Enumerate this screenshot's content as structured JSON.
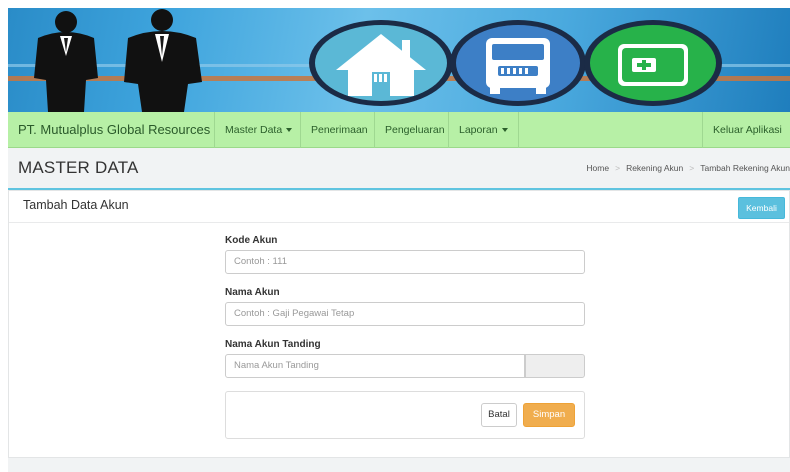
{
  "colors": {
    "navbar_bg": "#b7f0a6",
    "banner_sky": "#3ea4dd",
    "accent_info": "#5bc0de",
    "accent_warning": "#f0ad4e",
    "home_circle": "#5bb8d6",
    "bus_circle": "#3d7fc6",
    "wallet_circle": "#27b24a"
  },
  "banner": {
    "icons": [
      "businessman-silhouette",
      "businessman-silhouette",
      "home-icon",
      "bus-icon",
      "wallet-icon"
    ]
  },
  "navbar": {
    "brand": "PT. Mutualplus Global Resources",
    "items": [
      {
        "label": "Master Data",
        "dropdown": true
      },
      {
        "label": "Penerimaan",
        "dropdown": false
      },
      {
        "label": "Pengeluaran",
        "dropdown": false
      },
      {
        "label": "Laporan",
        "dropdown": true
      }
    ],
    "logout": "Keluar Aplikasi"
  },
  "header": {
    "title": "MASTER DATA",
    "breadcrumb": [
      "Home",
      "Rekening Akun",
      "Tambah Rekening Akun"
    ]
  },
  "panel": {
    "title": "Tambah Data Akun",
    "back_button": "Kembali"
  },
  "form": {
    "kode_label": "Kode Akun",
    "kode_placeholder": "Contoh : 111",
    "nama_label": "Nama Akun",
    "nama_placeholder": "Contoh : Gaji Pegawai Tetap",
    "tanding_label": "Nama Akun Tanding",
    "tanding_placeholder": "Nama Akun Tanding",
    "cancel_button": "Batal",
    "save_button": "Simpan"
  }
}
